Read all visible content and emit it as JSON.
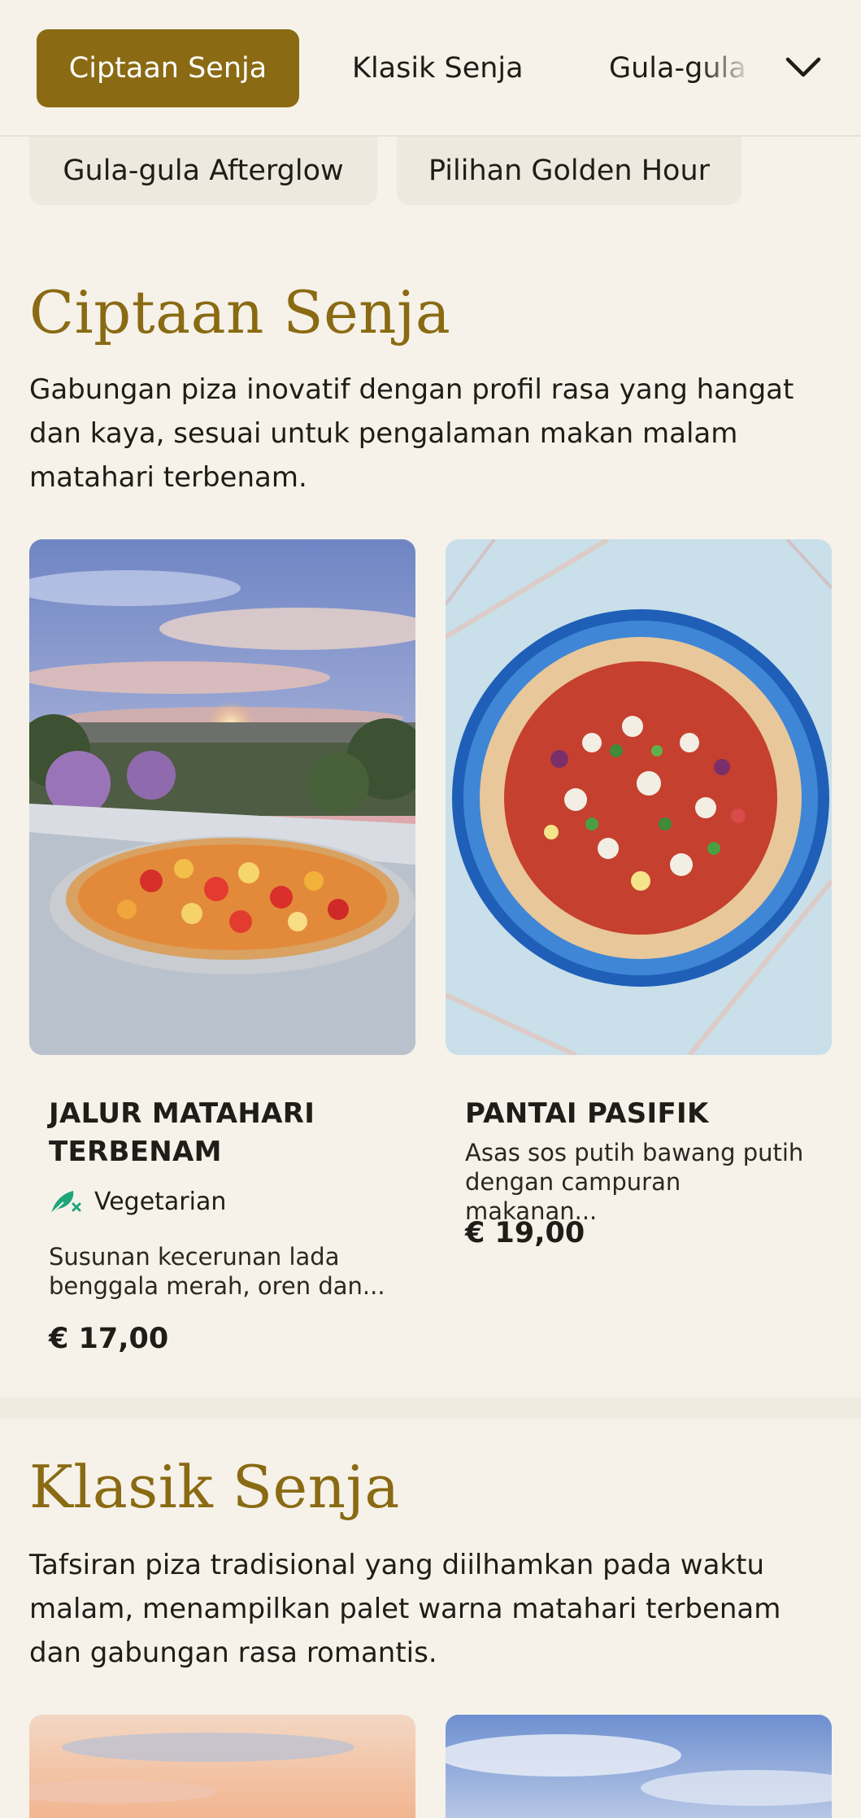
{
  "nav": {
    "active_tab": "Ciptaan Senja",
    "tab2": "Klasik Senja",
    "tab3": "Gula-gula Afterglow",
    "chips": [
      "Gula-gula Afterglow",
      "Pilihan Golden Hour"
    ],
    "accent_color": "#8a6a12"
  },
  "section1": {
    "title": "Ciptaan Senja",
    "description": "Gabungan piza inovatif dengan profil rasa yang hangat dan kaya, sesuai untuk pengalaman makan malam matahari terbenam.",
    "items": [
      {
        "name": "JALUR MATAHARI TERBENAM",
        "badge": "Vegetarian",
        "badge_icon": "vegetarian-leaf-icon",
        "description": "Susunan kecerunan lada benggala merah, oren dan...",
        "price": "€ 17,00"
      },
      {
        "name": "PANTAI PASIFIK",
        "description": "Asas sos putih bawang putih dengan campuran makanan...",
        "price": "€ 19,00"
      }
    ]
  },
  "section2": {
    "title": "Klasik Senja",
    "description": "Tafsiran piza tradisional yang diilhamkan pada waktu malam, menampilkan palet warna matahari terbenam dan gabungan rasa romantis."
  }
}
